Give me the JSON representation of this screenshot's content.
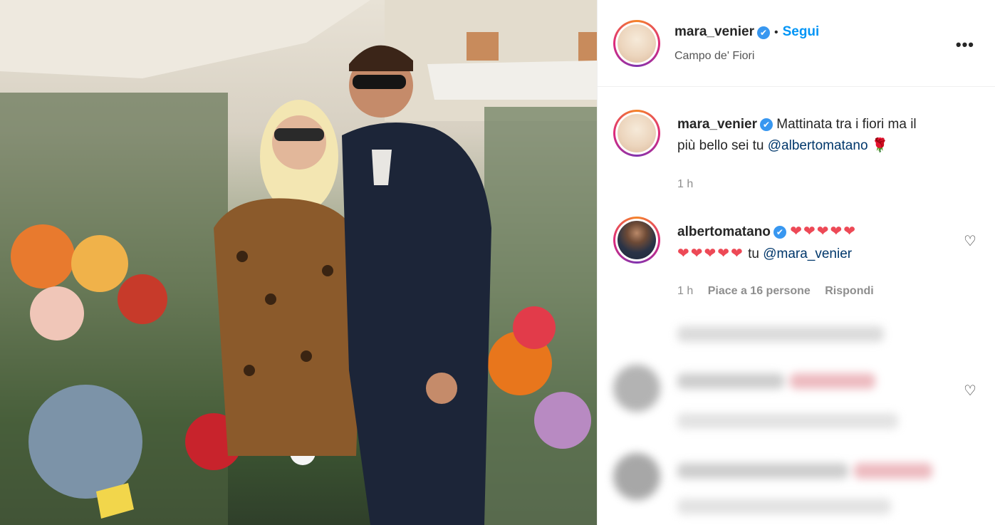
{
  "post": {
    "author": "mara_venier",
    "verified_mark": "✔",
    "separator": "•",
    "follow_label": "Segui",
    "location": "Campo de' Fiori",
    "more_icon": "•••"
  },
  "caption": {
    "author": "mara_venier",
    "text_line1": "Mattinata tra i fiori ma il",
    "text_line2": "più bello sei tu ",
    "mention": "@albertomatano",
    "emoji": "🌹",
    "time": "1 h"
  },
  "comments": [
    {
      "author": "albertomatano",
      "hearts_line1": "❤❤❤❤❤",
      "hearts_line2": "❤❤❤❤❤",
      "text": " tu ",
      "mention": "@mara_venier",
      "time": "1 h",
      "likes": "Piace a 16 persone",
      "reply_label": "Rispondi"
    }
  ],
  "icons": {
    "like": "heart-outline-icon"
  },
  "colors": {
    "accent": "#0095f6",
    "verified": "#3897f0",
    "heart": "#ed4956"
  }
}
